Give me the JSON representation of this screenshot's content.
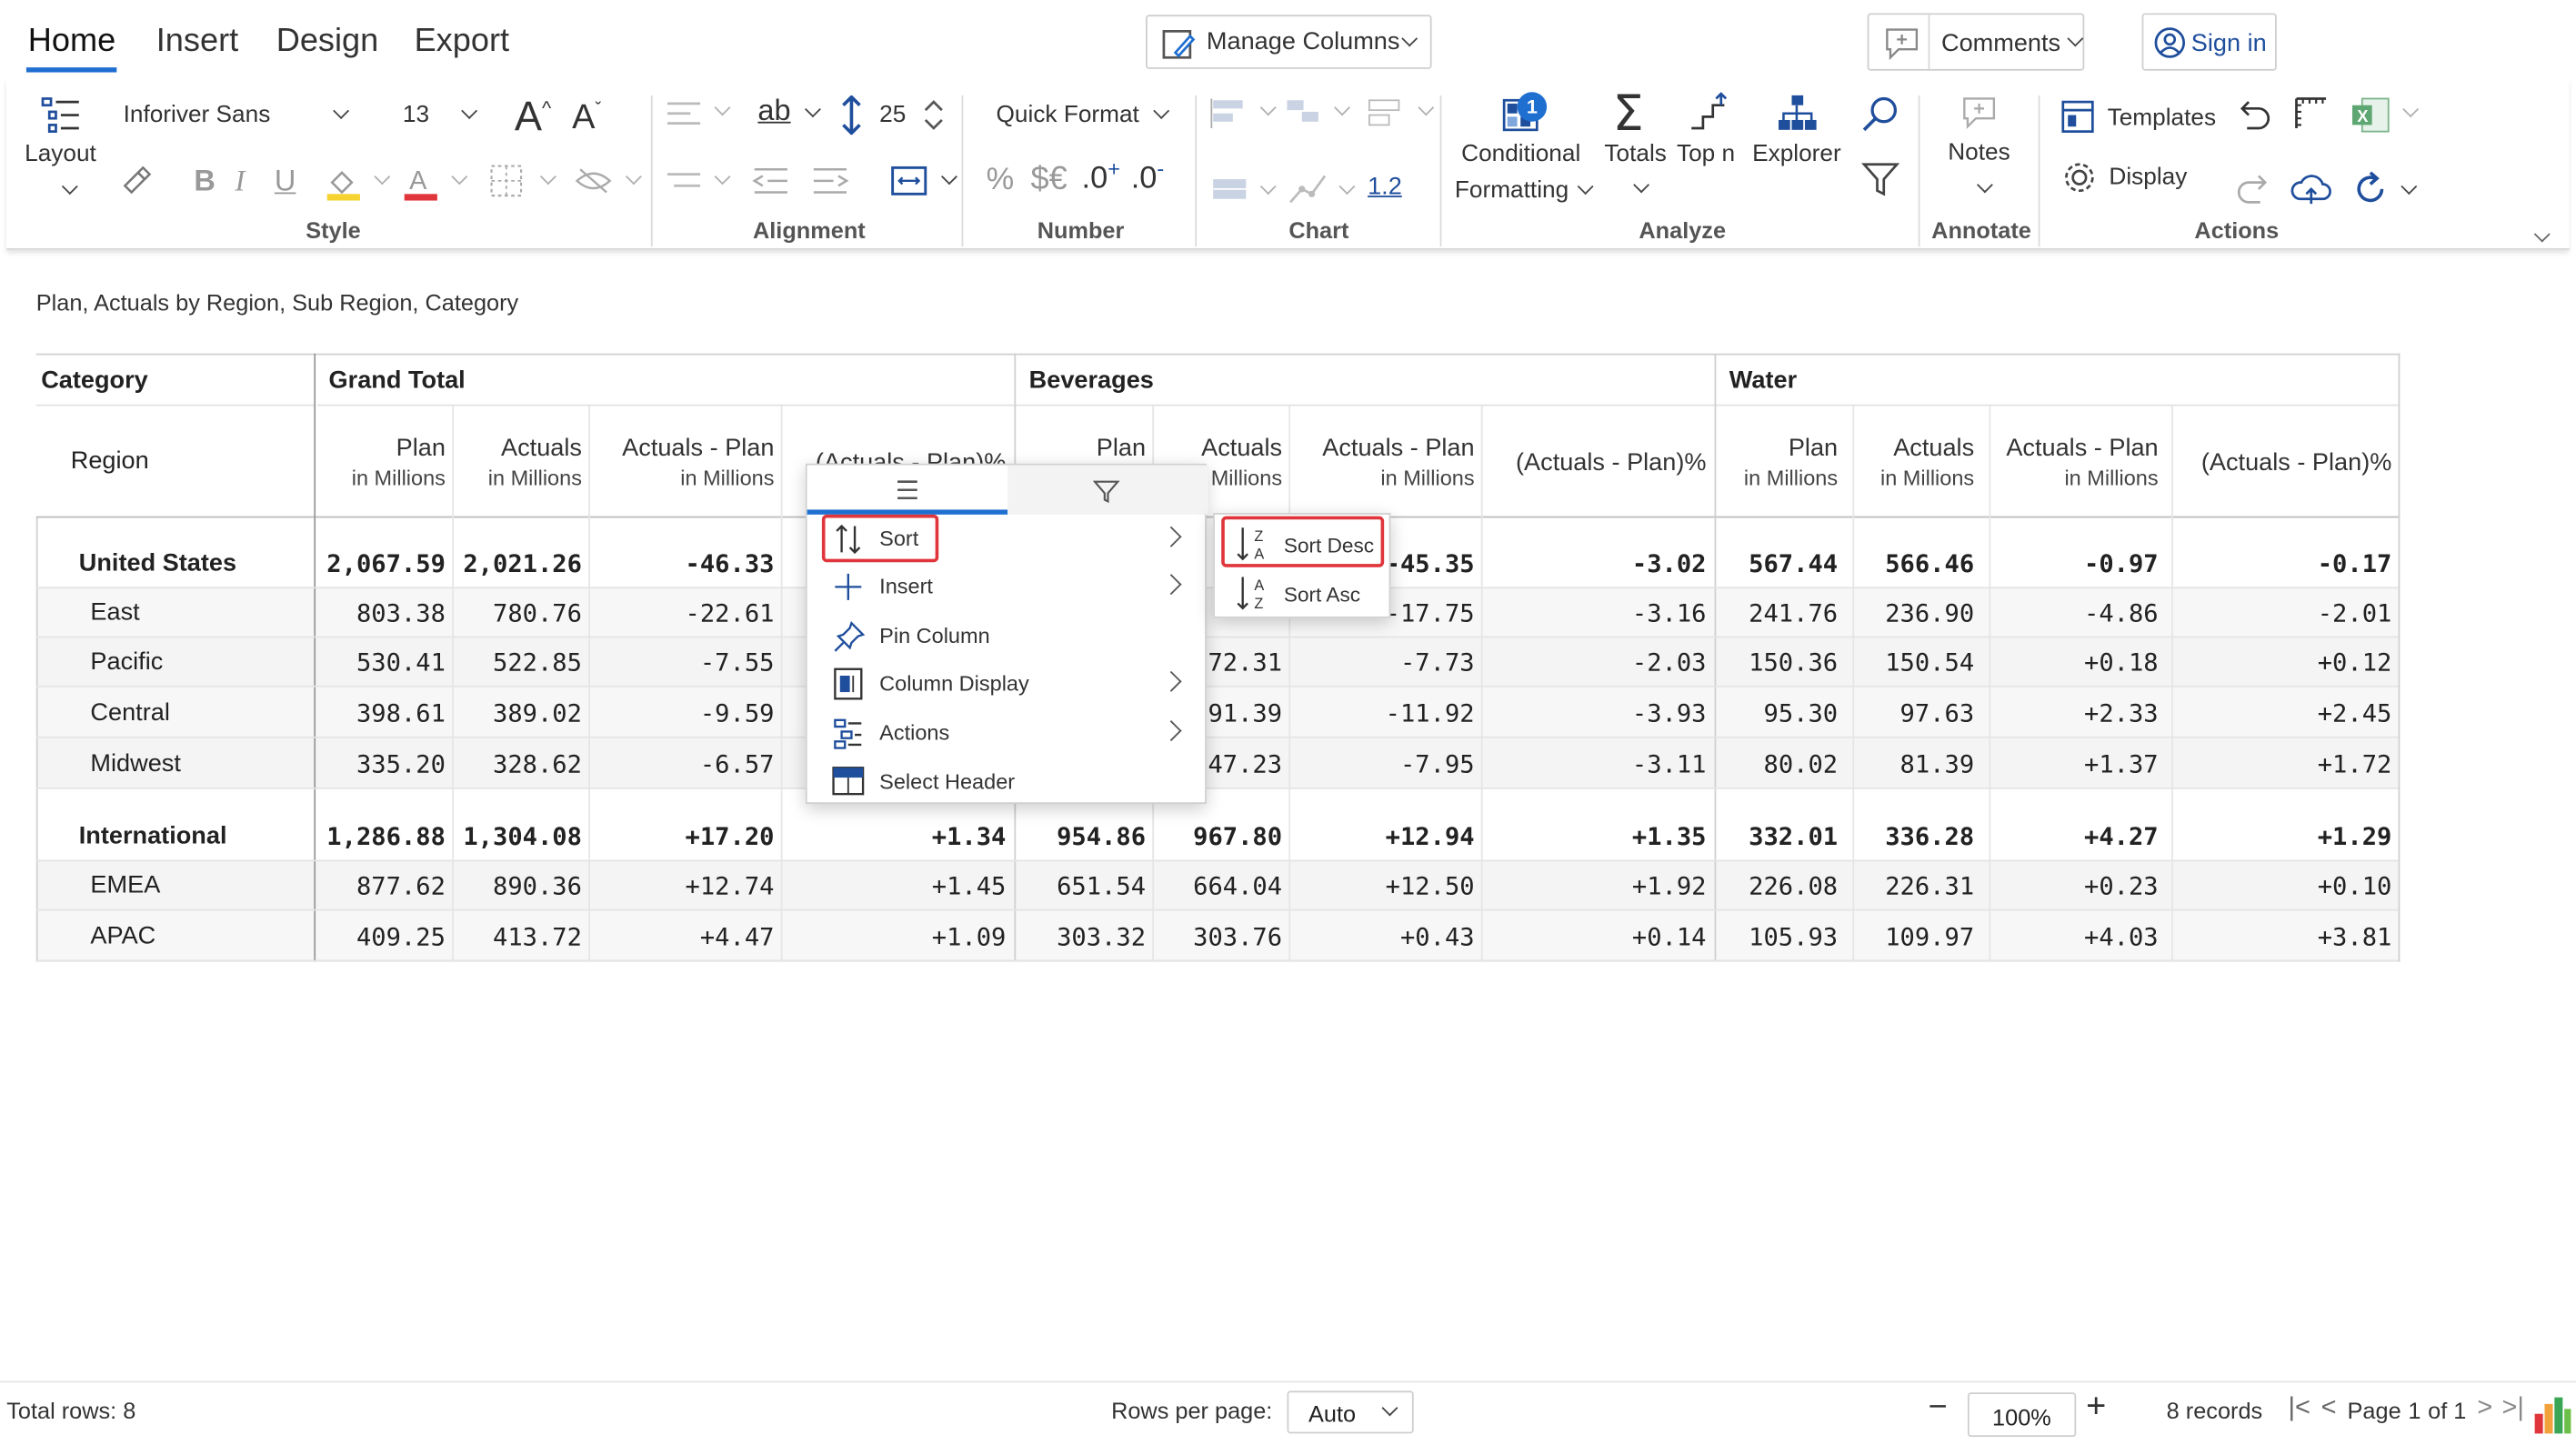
{
  "tabs": [
    "Home",
    "Insert",
    "Design",
    "Export"
  ],
  "active_tab": "Home",
  "manage_columns": "Manage Columns",
  "comments": "Comments",
  "sign_in": "Sign in",
  "ribbon": {
    "layout": "Layout",
    "font_name": "Inforiver Sans",
    "font_size": "13",
    "row_height": "25",
    "quick_format": "Quick Format",
    "decimals_label": "1.2",
    "conditional": "Conditional",
    "formatting": "Formatting",
    "totals": "Totals",
    "topn": "Top n",
    "explorer": "Explorer",
    "notes": "Notes",
    "templates": "Templates",
    "display": "Display",
    "groups": {
      "style": "Style",
      "alignment": "Alignment",
      "number": "Number",
      "chart": "Chart",
      "analyze": "Analyze",
      "annotate": "Annotate",
      "actions": "Actions"
    },
    "badge": "1",
    "accent": "#1f6fd1"
  },
  "subtitle": "Plan, Actuals by Region, Sub Region, Category",
  "table": {
    "corner_top": "Category",
    "corner_bottom": "Region",
    "groups": [
      "Grand Total",
      "Beverages",
      "Water"
    ],
    "columns": [
      {
        "title": "Plan",
        "unit": "in Millions"
      },
      {
        "title": "Actuals",
        "unit": "in Millions"
      },
      {
        "title": "Actuals - Plan",
        "unit": "in Millions"
      },
      {
        "title": "(Actuals - Plan)%",
        "unit": ""
      }
    ],
    "rows": [
      {
        "label": "United States",
        "bold": true,
        "values": [
          "2,067.59",
          "2,021.26",
          "-46.33",
          "",
          "",
          "",
          "-45.35",
          "-3.02",
          "567.44",
          "566.46",
          "-0.97",
          "-0.17"
        ]
      },
      {
        "label": "East",
        "bold": false,
        "values": [
          "803.38",
          "780.76",
          "-22.61",
          "",
          "",
          "",
          "-17.75",
          "-3.16",
          "241.76",
          "236.90",
          "-4.86",
          "-2.01"
        ]
      },
      {
        "label": "Pacific",
        "bold": false,
        "values": [
          "530.41",
          "522.85",
          "-7.55",
          "",
          "",
          "72.31",
          "-7.73",
          "-2.03",
          "150.36",
          "150.54",
          "+0.18",
          "+0.12"
        ]
      },
      {
        "label": "Central",
        "bold": false,
        "values": [
          "398.61",
          "389.02",
          "-9.59",
          "",
          "",
          "91.39",
          "-11.92",
          "-3.93",
          "95.30",
          "97.63",
          "+2.33",
          "+2.45"
        ]
      },
      {
        "label": "Midwest",
        "bold": false,
        "values": [
          "335.20",
          "328.62",
          "-6.57",
          "",
          "",
          "47.23",
          "-7.95",
          "-3.11",
          "80.02",
          "81.39",
          "+1.37",
          "+1.72"
        ]
      },
      {
        "label": "International",
        "bold": true,
        "values": [
          "1,286.88",
          "1,304.08",
          "+17.20",
          "+1.34",
          "954.86",
          "967.80",
          "+12.94",
          "+1.35",
          "332.01",
          "336.28",
          "+4.27",
          "+1.29"
        ]
      },
      {
        "label": "EMEA",
        "bold": false,
        "values": [
          "877.62",
          "890.36",
          "+12.74",
          "+1.45",
          "651.54",
          "664.04",
          "+12.50",
          "+1.92",
          "226.08",
          "226.31",
          "+0.23",
          "+0.10"
        ]
      },
      {
        "label": "APAC",
        "bold": false,
        "values": [
          "409.25",
          "413.72",
          "+4.47",
          "+1.09",
          "303.32",
          "303.76",
          "+0.43",
          "+0.14",
          "105.93",
          "109.97",
          "+4.03",
          "+3.81"
        ]
      }
    ],
    "partial_header_grand": "(Actuals - Plan)%",
    "partial_header_bev_actuals": "Actuals",
    "partial_header_bev_unit": "Millions"
  },
  "context_menu": {
    "items": [
      {
        "label": "Sort",
        "submenu": true
      },
      {
        "label": "Insert",
        "submenu": true
      },
      {
        "label": "Pin Column",
        "submenu": false
      },
      {
        "label": "Column Display",
        "submenu": true
      },
      {
        "label": "Actions",
        "submenu": true
      },
      {
        "label": "Select Header",
        "submenu": false
      }
    ],
    "submenu": [
      "Sort Desc",
      "Sort Asc"
    ],
    "highlight_color": "#e0353b"
  },
  "footer": {
    "total_rows": "Total rows: 8",
    "rows_per_page_label": "Rows per page:",
    "rows_per_page": "Auto",
    "zoom": "100%",
    "records": "8 records",
    "page": "Page",
    "page_num": "1",
    "page_of": "of 1"
  }
}
